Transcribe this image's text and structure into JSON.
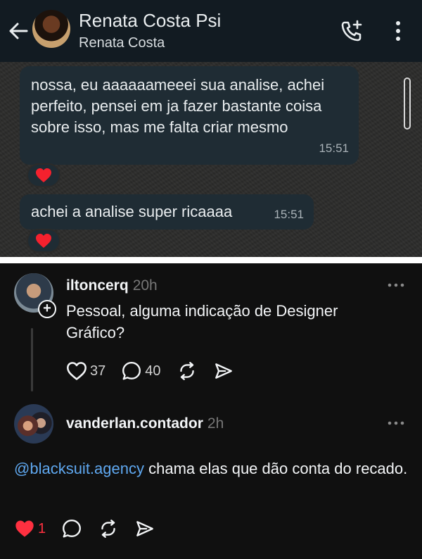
{
  "whatsapp": {
    "contact_name": "Renata Costa Psi",
    "contact_subtitle": "Renata Costa",
    "icons": {
      "back": "arrow-left-icon",
      "call": "add-call-icon",
      "menu": "more-vertical-icon"
    },
    "messages": [
      {
        "text": "nossa, eu aaaaaameeei sua analise, achei perfeito, pensei em ja fazer bastante coisa sobre isso, mas me falta criar mesmo",
        "time": "15:51",
        "reaction": "❤️"
      },
      {
        "text": "achei a analise super ricaaaa",
        "time": "15:51",
        "reaction": "❤️"
      }
    ]
  },
  "threads": {
    "post": {
      "username": "iltoncerq",
      "ago": "20h",
      "text": "Pessoal, alguma indicação de Designer Gráfico?",
      "likes": "37",
      "replies": "40"
    },
    "reply": {
      "username": "vanderlan.contador",
      "ago": "2h",
      "mention": "@blacksuit.agency",
      "text": " chama elas que dão conta do recado.",
      "likes": "1"
    },
    "colors": {
      "like_active": "#ff3040",
      "mention": "#5fa8f0",
      "background": "#101010"
    }
  }
}
